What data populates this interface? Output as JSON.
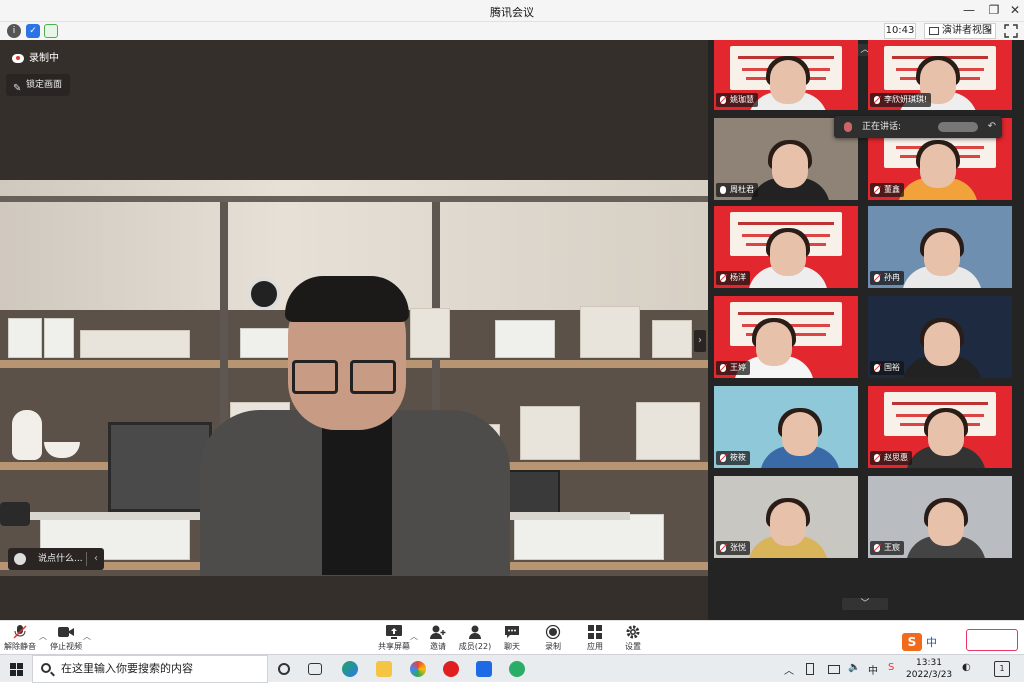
{
  "window": {
    "title": "腾讯会议"
  },
  "topbar": {
    "time": "10:43",
    "view_label": "演讲者视图"
  },
  "main": {
    "recording_label": "录制中",
    "lock_label": "锁定画面",
    "chat_placeholder": "说点什么..."
  },
  "gallery": {
    "speaking_label": "正在讲话:",
    "tiles": [
      {
        "name": "姚珈慧",
        "muted": true
      },
      {
        "name": "李欣妍琪琪!",
        "muted": true
      },
      {
        "name": "周杜君",
        "muted": false
      },
      {
        "name": "董鑫",
        "muted": true
      },
      {
        "name": "杨洋",
        "muted": true
      },
      {
        "name": "孙冉",
        "muted": true
      },
      {
        "name": "王婷",
        "muted": true
      },
      {
        "name": "国裕",
        "muted": true
      },
      {
        "name": "筱筱",
        "muted": true
      },
      {
        "name": "赵思惠",
        "muted": true
      },
      {
        "name": "张悦",
        "muted": true
      },
      {
        "name": "王宸",
        "muted": true
      }
    ]
  },
  "toolbar": {
    "unmute": "解除静音",
    "stop_video": "停止视频",
    "share_screen": "共享屏幕",
    "invite": "邀请",
    "members": "成员(22)",
    "chat": "聊天",
    "record": "录制",
    "apps": "应用",
    "settings": "设置",
    "ime_lang": "中"
  },
  "taskbar": {
    "search_placeholder": "在这里输入你要搜索的内容",
    "time": "13:31",
    "date": "2022/3/23",
    "notifications": "1"
  },
  "colors": {
    "banner_red": "#e2282e",
    "main_bg": "#352f2b",
    "gallery_bg": "#242424",
    "accent_blue": "#1a55c9"
  }
}
